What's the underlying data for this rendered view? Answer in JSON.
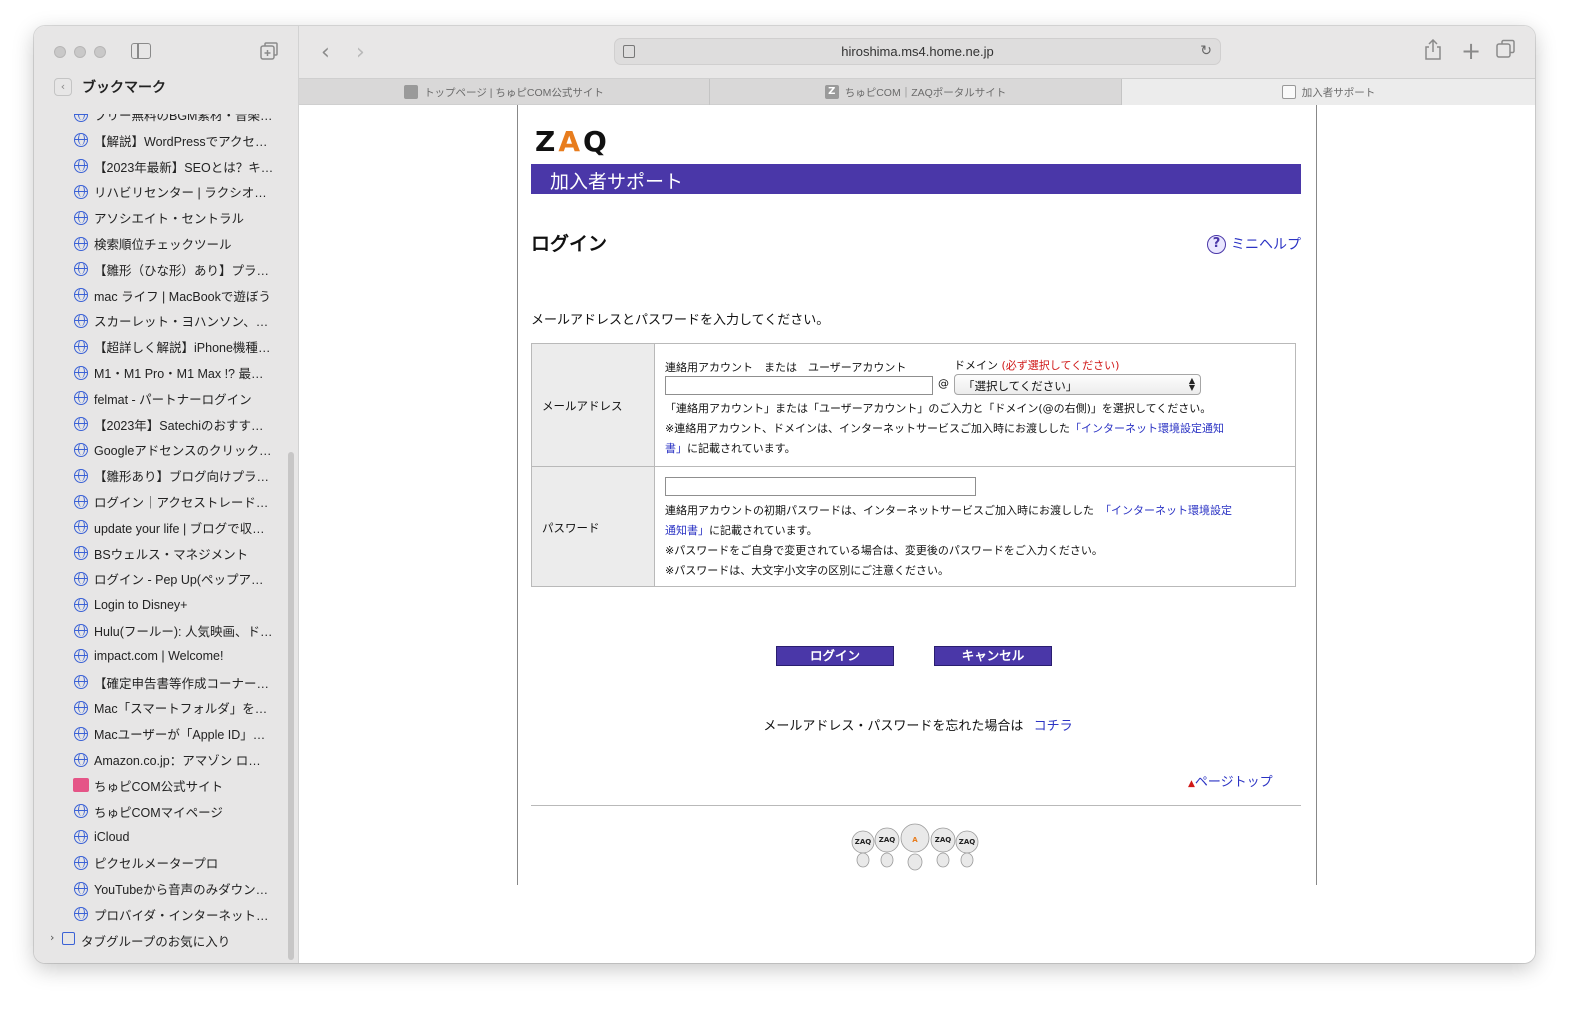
{
  "browser": {
    "url": "hiroshima.ms4.home.ne.jp",
    "tabs": [
      {
        "label": "トップページ | ちゅピCOM公式サイト"
      },
      {
        "label": "ちゅピCOM｜ZAQポータルサイト"
      },
      {
        "label": "加入者サポート"
      }
    ]
  },
  "sidebar": {
    "title": "ブックマーク",
    "items": [
      {
        "label": "フリー無料のBGM素材・音楽…"
      },
      {
        "label": "【解説】WordPressでアクセス…"
      },
      {
        "label": "【2023年最新】SEOとは？キ…"
      },
      {
        "label": "リハビリセンター | ラクシオン…"
      },
      {
        "label": "アソシエイト・セントラル"
      },
      {
        "label": "検索順位チェックツール"
      },
      {
        "label": "【雛形（ひな形）あり】プライバ…"
      },
      {
        "label": "mac ライフ | MacBookで遊ぼう"
      },
      {
        "label": "スカーレット・ヨハンソン、…"
      },
      {
        "label": "【超詳しく解説】iPhone機種変…"
      },
      {
        "label": "M1・M1 Pro・M1 Max !? 最…"
      },
      {
        "label": "felmat - パートナーログイン"
      },
      {
        "label": "【2023年】Satechiのおすすめ…"
      },
      {
        "label": "Googleアドセンスのクリック…"
      },
      {
        "label": "【雛形あり】ブログ向けプライ…"
      },
      {
        "label": "ログイン｜アクセストレード…"
      },
      {
        "label": "update your life | ブログで収…"
      },
      {
        "label": "BSウェルス・マネジメント"
      },
      {
        "label": "ログイン - Pep Up(ペップア…"
      },
      {
        "label": "Login to Disney+"
      },
      {
        "label": "Hulu(フールー): 人気映画、ド…"
      },
      {
        "label": "impact.com | Welcome!"
      },
      {
        "label": "【確定申告書等作成コーナー】-…"
      },
      {
        "label": "Mac「スマートフォルダ」を活…"
      },
      {
        "label": "Macユーザーが「Apple ID」…"
      },
      {
        "label": "Amazon.co.jp：アマゾン ロ…"
      },
      {
        "label": "ちゅピCOM公式サイト",
        "icon": "pink"
      },
      {
        "label": "ちゅピCOMマイページ"
      },
      {
        "label": "iCloud"
      },
      {
        "label": "ピクセルメータープロ"
      },
      {
        "label": "YouTubeから音声のみダウン…"
      },
      {
        "label": "プロバイダ・インターネット…"
      }
    ],
    "tab_group_label": "タブグループのお気に入り"
  },
  "page": {
    "logo": {
      "z": "Z",
      "a": "A",
      "q": "Q"
    },
    "banner": "加入者サポート",
    "heading": "ログイン",
    "minihelp": "ミニヘルプ",
    "instruction": "メールアドレスとパスワードを入力してください。",
    "email": {
      "label": "メールアドレス",
      "account_caption": "連絡用アカウント　または　ユーザーアカウント",
      "domain_caption": "ドメイン",
      "domain_required": "(必ず選択してください)",
      "at": "@",
      "select_value": "「選択してください」",
      "note1": "「連絡用アカウント」または「ユーザーアカウント」のご入力と「ドメイン(@の右側)」を選択してください。",
      "note2_pre": "※連絡用アカウント、ドメインは、インターネットサービスご加入時にお渡しした",
      "note2_link_a": "「インターネット環境設定通知",
      "note2_link_b": "書」",
      "note2_post": "に記載されています。"
    },
    "password": {
      "label": "パスワード",
      "note1_pre": "連絡用アカウントの初期パスワードは、インターネットサービスご加入時にお渡しした",
      "note1_link_a": "「インターネット環境設定",
      "note1_link_b": "通知書」",
      "note1_post": "に記載されています。",
      "note2": "※パスワードをご自身で変更されている場合は、変更後のパスワードをご入力ください。",
      "note3": "※パスワードは、大文字小文字の区別にご注意ください。"
    },
    "login_button": "ログイン",
    "cancel_button": "キャンセル",
    "forgot_text": "メールアドレス・パスワードを忘れた場合は",
    "forgot_link": "コチラ",
    "page_top": "ページトップ",
    "mascot_text": "ZAQ ZAQ A ZAQ ZAQ"
  }
}
